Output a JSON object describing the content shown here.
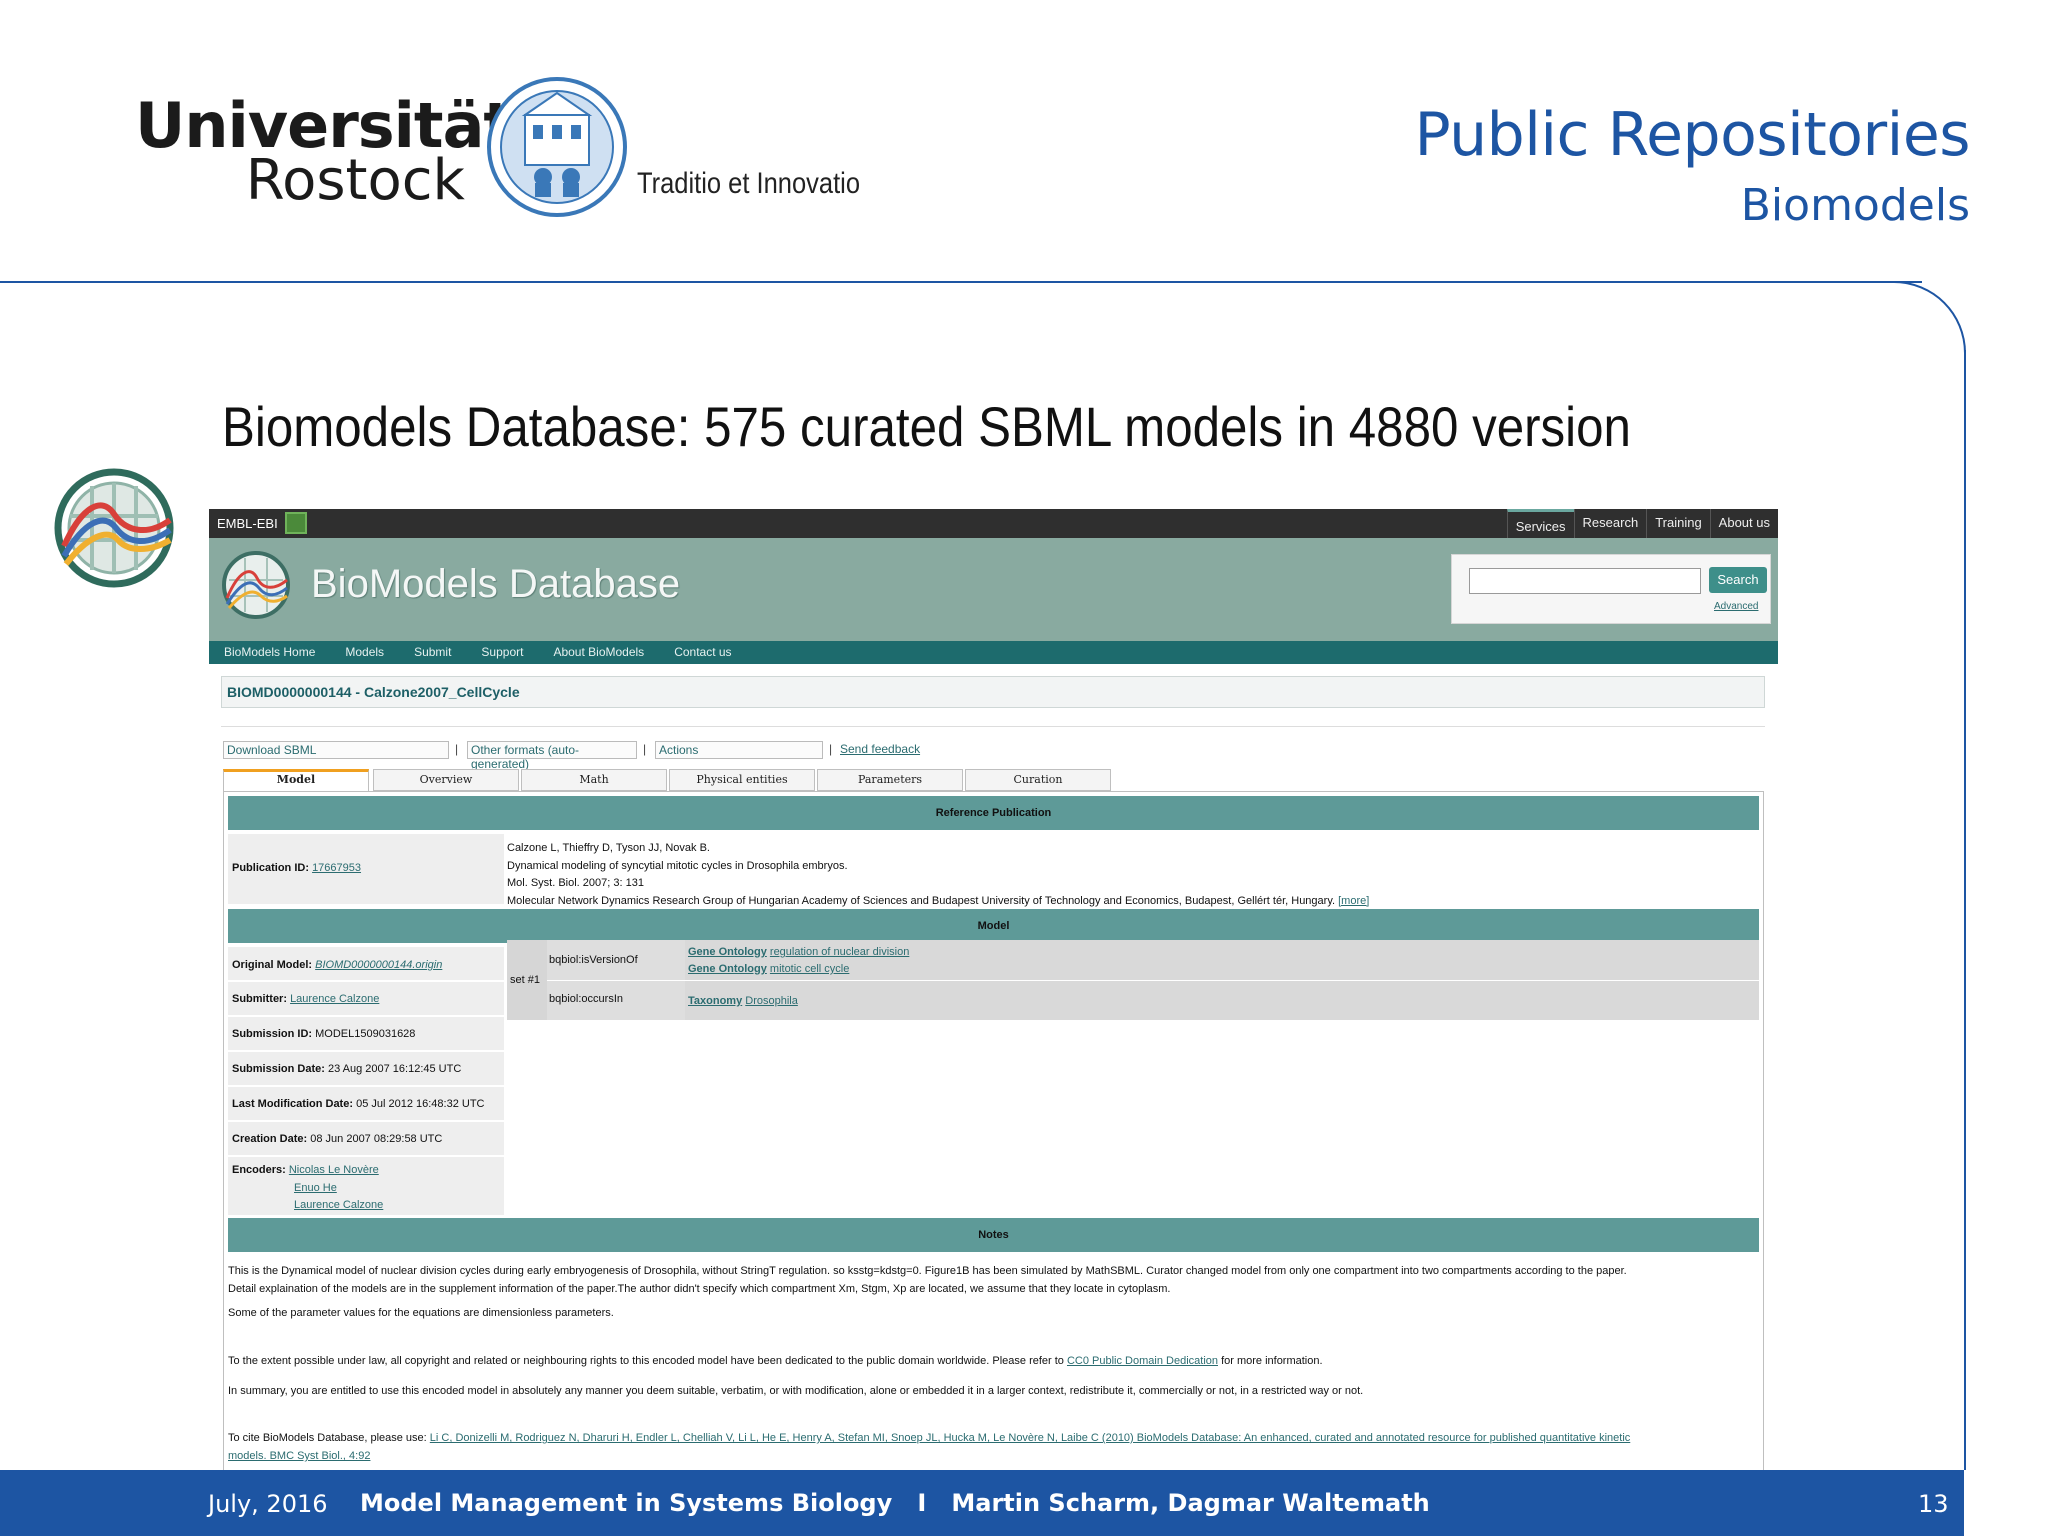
{
  "slide": {
    "university_line1": "Universität",
    "university_line2": "Rostock",
    "motto": "Traditio et Innovatio",
    "title": "Public Repositories",
    "subtitle": "Biomodels",
    "headline": "Biomodels Database: 575 curated SBML models in 4880 version",
    "footer": {
      "date": "July, 2016",
      "talk": "Model Management in Systems Biology",
      "separator": "I",
      "authors": "Martin Scharm, Dagmar Waltemath",
      "page": "13"
    },
    "colors": {
      "brand_blue": "#1d55a3"
    }
  },
  "browser": {
    "topbar": {
      "brand": "EMBL-EBI",
      "nav": [
        "Services",
        "Research",
        "Training",
        "About us"
      ]
    },
    "banner": {
      "title": "BioModels Database"
    },
    "search": {
      "button": "Search",
      "advanced": "Advanced",
      "value": ""
    },
    "nav": [
      "BioModels Home",
      "Models",
      "Submit",
      "Support",
      "About BioModels",
      "Contact us"
    ],
    "model_title": "BIOMD0000000144 - Calzone2007_CellCycle",
    "actions": {
      "download": "Download SBML",
      "other_formats": "Other formats (auto-generated)",
      "actions": "Actions",
      "sep": "|",
      "feedback": "Send feedback"
    },
    "tabs": [
      "Model",
      "Overview",
      "Math",
      "Physical entities",
      "Parameters",
      "Curation"
    ],
    "sections": {
      "reference": "Reference Publication",
      "model": "Model",
      "notes": "Notes"
    },
    "publication": {
      "label": "Publication ID:",
      "id": "17667953",
      "authors": "Calzone L, Thieffry D, Tyson JJ, Novak B.",
      "title": "Dynamical modeling of syncytial mitotic cycles in Drosophila embryos.",
      "journal": "Mol. Syst. Biol. 2007; 3: 131",
      "affiliation": "Molecular Network Dynamics Research Group of Hungarian Academy of Sciences and Budapest University of Technology and Economics, Budapest, Gellért tér, Hungary.",
      "more": "[more]"
    },
    "model_info": {
      "original_label": "Original Model:",
      "original_value": "BIOMD0000000144.origin",
      "submitter_label": "Submitter:",
      "submitter_value": "Laurence Calzone",
      "submission_id_label": "Submission ID:",
      "submission_id_value": "MODEL1509031628",
      "submission_date_label": "Submission Date:",
      "submission_date_value": "23 Aug 2007 16:12:45 UTC",
      "lastmod_label": "Last Modification Date:",
      "lastmod_value": "05 Jul 2012 16:48:32 UTC",
      "creation_label": "Creation Date:",
      "creation_value": "08 Jun 2007 08:29:58 UTC",
      "encoders_label": "Encoders:",
      "encoders": [
        "Nicolas Le Novère",
        "Enuo He",
        "Laurence Calzone"
      ]
    },
    "annotations": {
      "set": "set #1",
      "q1": "bqbiol:isVersionOf",
      "q1_values": [
        {
          "ontology": "Gene Ontology",
          "term": "regulation of nuclear division"
        },
        {
          "ontology": "Gene Ontology",
          "term": "mitotic cell cycle"
        }
      ],
      "q2": "bqbiol:occursIn",
      "q2_values": [
        {
          "ontology": "Taxonomy",
          "term": "Drosophila"
        }
      ]
    },
    "notes": {
      "p1": "This is the Dynamical model of nuclear division cycles during early embryogenesis of Drosophila, without StringT regulation. so ksstg=kdstg=0. Figure1B has been simulated by MathSBML. Curator changed model from only one compartment into two compartments according to the paper.",
      "p1b": "Detail explaination of the models are in the supplement information of the paper.The author didn't specify which compartment Xm, Stgm, Xp are located, we assume that they locate in cytoplasm.",
      "p2": "Some of the parameter values for the equations are dimensionless parameters.",
      "p3_pre": "To the extent possible under law, all copyright and related or neighbouring rights to this encoded model have been dedicated to the public domain worldwide. Please refer to",
      "p3_link": "CC0 Public Domain Dedication",
      "p3_post": "for more information.",
      "p4": "In summary, you are entitled to use this encoded model in absolutely any manner you deem suitable, verbatim, or with modification, alone or embedded it in a larger context, redistribute it, commercially or not, in a restricted way or not.",
      "p5_pre": "To cite BioModels Database, please use:",
      "p5_link": "Li C, Donizelli M, Rodriguez N, Dharuri H, Endler L, Chelliah V, Li L, He E, Henry A, Stefan MI, Snoep JL, Hucka M, Le Novère N, Laibe C (2010) BioModels Database: An enhanced, curated and annotated resource for published quantitative kinetic",
      "p5_link2": "models. BMC Syst Biol., 4:92"
    }
  }
}
